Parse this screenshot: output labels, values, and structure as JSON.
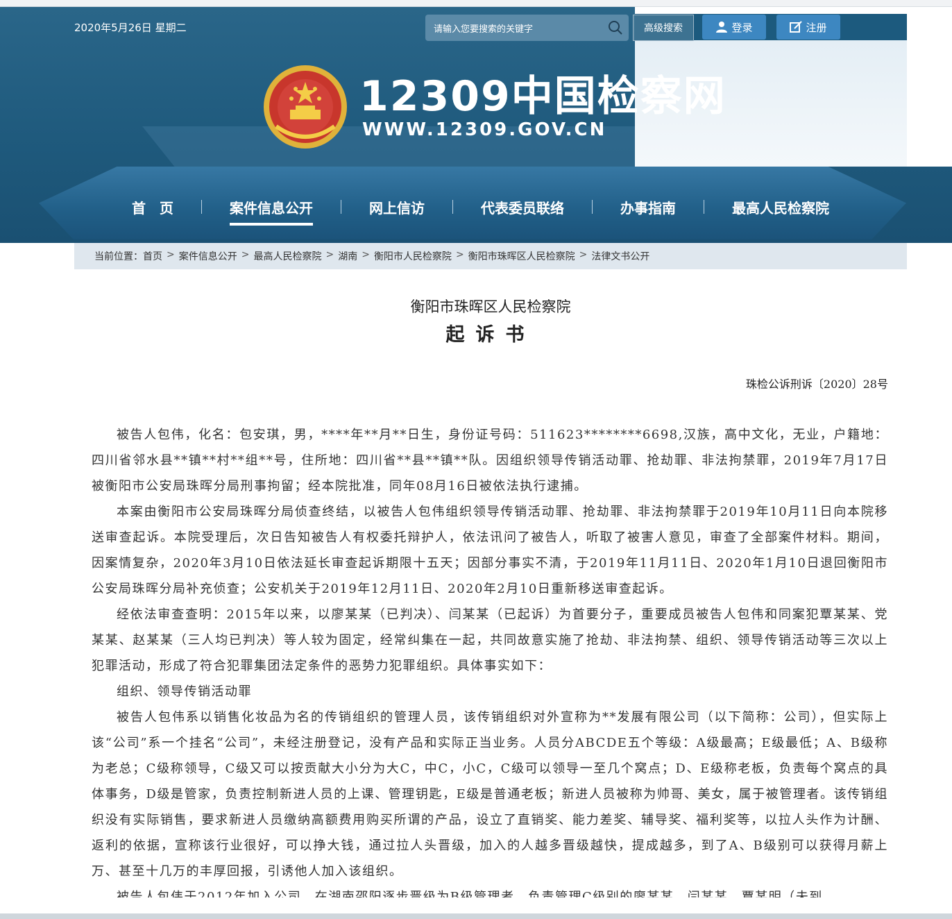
{
  "header": {
    "date": "2020年5月26日 星期二",
    "search_placeholder": "请输入您要搜索的关键字",
    "advanced_search": "高级搜索",
    "login": "登录",
    "register": "注册"
  },
  "brand": {
    "title": "12309中国检察网",
    "url": "WWW.12309.GOV.CN"
  },
  "nav": {
    "items": [
      {
        "label": "首　页"
      },
      {
        "label": "案件信息公开"
      },
      {
        "label": "网上信访"
      },
      {
        "label": "代表委员联络"
      },
      {
        "label": "办事指南"
      },
      {
        "label": "最高人民检察院"
      }
    ],
    "active_index": 1
  },
  "breadcrumb": {
    "prefix": "当前位置：",
    "items": [
      "首页",
      "案件信息公开",
      "最高人民检察院",
      "湖南",
      "衡阳市人民检察院",
      "衡阳市珠晖区人民检察院",
      "法律文书公开"
    ]
  },
  "document": {
    "org": "衡阳市珠晖区人民检察院",
    "type": "起诉书",
    "number": "珠检公诉刑诉〔2020〕28号",
    "paragraphs": [
      "被告人包伟，化名：包安琪，男，****年**月**日生，身份证号码：511623********6698,汉族，高中文化，无业，户籍地：四川省邻水县**镇**村**组**号，住所地：四川省**县**镇**队。因组织领导传销活动罪、抢劫罪、非法拘禁罪，2019年7月17日被衡阳市公安局珠晖分局刑事拘留；经本院批准，同年08月16日被依法执行逮捕。",
      "本案由衡阳市公安局珠晖分局侦查终结，以被告人包伟组织领导传销活动罪、抢劫罪、非法拘禁罪于2019年10月11日向本院移送审查起诉。本院受理后，次日告知被告人有权委托辩护人，依法讯问了被告人，听取了被害人意见，审查了全部案件材料。期间，因案情复杂，2020年3月10日依法延长审查起诉期限十五天；因部分事实不清，于2019年11月11日、2020年1月10日退回衡阳市公安局珠晖分局补充侦查；公安机关于2019年12月11日、2020年2月10日重新移送审查起诉。",
      "经依法审查查明：2015年以来，以廖某某（已判决）、闫某某（已起诉）为首要分子，重要成员被告人包伟和同案犯覃某某、党某某、赵某某（三人均已判决）等人较为固定，经常纠集在一起，共同故意实施了抢劫、非法拘禁、组织、领导传销活动等三次以上犯罪活动，形成了符合犯罪集团法定条件的恶势力犯罪组织。具体事实如下：",
      "组织、领导传销活动罪",
      "被告人包伟系以销售化妆品为名的传销组织的管理人员，该传销组织对外宣称为**发展有限公司（以下简称：公司），但实际上该“公司”系一个挂名“公司”，未经注册登记，没有产品和实际正当业务。人员分ABCDE五个等级：A级最高；E级最低；A、B级称为老总；C级称领导，C级又可以按贡献大小分为大C，中C，小C，C级可以领导一至几个窝点；D、E级称老板，负责每个窝点的具体事务，D级是管家，负责控制新进人员的上课、管理钥匙，E级是普通老板；新进人员被称为帅哥、美女，属于被管理者。该传销组织没有实际销售，要求新进人员缴纳高额费用购买所谓的产品，设立了直销奖、能力差奖、辅导奖、福利奖等，以拉人头作为计酬、返利的依据，宣称该行业很好，可以挣大钱，通过拉人头晋级，加入的人越多晋级越快，提成越多，到了A、B级别可以获得月薪上万、甚至十几万的丰厚回报，引诱他人加入该组织。",
      "被告人包伟于2012年加入公司，在湖南邵阳逐步晋级为B级管理者，负责管理C级别的廖某某、闫某某、覃某明（未到"
    ]
  },
  "colors": {
    "header_bg": "#1f5a7d",
    "button_bg": "#3d87c1",
    "breadcrumb_bg": "#dfe7ee"
  }
}
